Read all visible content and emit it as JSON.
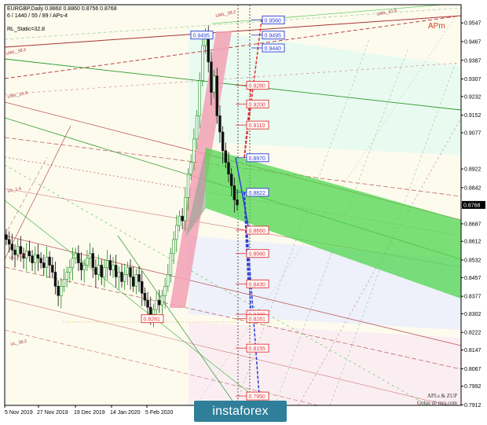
{
  "header": {
    "line1": "EURGBP,Daily  0.8860 0.8860 0.8756 0.8768",
    "line2": "6 / 1440 / 55 / 89 / APs-4",
    "line3": "RL_Static=32.8"
  },
  "chart_data": {
    "type": "candlestick",
    "symbol": "EURGBP",
    "timeframe": "Daily",
    "ohlc_last": [
      0.886,
      0.886,
      0.8756,
      0.8768
    ],
    "current_price": 0.8768,
    "ylim": [
      0.791,
      0.9625
    ],
    "y_ticks": [
      "0.9547",
      "0.9467",
      "0.9387",
      "0.9307",
      "0.9232",
      "0.9152",
      "0.9077",
      "0.8922",
      "0.8842",
      "0.8768",
      "0.8687",
      "0.8612",
      "0.8532",
      "0.8457",
      "0.8377",
      "0.8302",
      "0.8222",
      "0.8147",
      "0.8067",
      "0.7992",
      "0.7912"
    ],
    "x_ticks": [
      "5 Nov 2019",
      "27 Nov 2019",
      "19 Dec 2019",
      "14 Jan 2020",
      "5 Feb 2020"
    ],
    "levels": [
      {
        "value": "0.9560",
        "color": "#2a3cd6"
      },
      {
        "value": "0.9495",
        "color": "#2a3cd6"
      },
      {
        "value": "0.9440",
        "color": "#2a3cd6"
      },
      {
        "value": "0.9280",
        "color": "#e03030"
      },
      {
        "value": "0.9200",
        "color": "#e03030"
      },
      {
        "value": "0.9110",
        "color": "#e03030"
      },
      {
        "value": "0.8970",
        "color": "#2a3cd6"
      },
      {
        "value": "0.8822",
        "color": "#2a3cd6"
      },
      {
        "value": "0.8660",
        "color": "#e03030"
      },
      {
        "value": "0.8560",
        "color": "#e03030"
      },
      {
        "value": "0.8430",
        "color": "#e03030"
      },
      {
        "value": "0.8300",
        "color": "#e03030"
      },
      {
        "value": "0.8281",
        "color": "#e03030"
      },
      {
        "value": "0.8155",
        "color": "#e03030"
      },
      {
        "value": "0.7950",
        "color": "#e03030"
      }
    ],
    "marks": [
      {
        "label": "0.9495",
        "x": "peak"
      },
      {
        "label": "0.8281",
        "x": "low"
      }
    ],
    "line_labels": [
      "UWL_38.2",
      "UWL_38.2",
      "UWL_61.8",
      "UWL_61.8",
      "UL_1.6",
      "UL_61.8",
      "UL_38.2"
    ]
  },
  "signature": {
    "line1": "APLs & ZUP",
    "line2": "Golos @ mrs.com"
  },
  "apm_label": "APm",
  "logo_text": "instaforex",
  "colors": {
    "bullish": "#1a8f1a",
    "bearish": "#111111",
    "green_channel": "#33cc33",
    "pink_zone": "#f2a0b4",
    "blue_arrow": "#2a3cd6",
    "red_arrow": "#e03030"
  }
}
